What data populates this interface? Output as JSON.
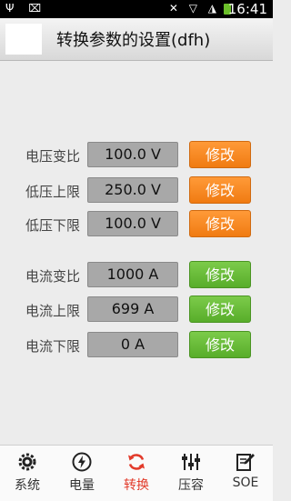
{
  "status_bar": {
    "left_icons": "Ψ ⌧",
    "right_icons": "✕ ▽ ◮",
    "time": "16:41"
  },
  "title_bar": {
    "title": "转换参数的设置(dfh)"
  },
  "rows": [
    {
      "label": "电压变比",
      "value": "100.0 V",
      "button": "修改",
      "color": "orange"
    },
    {
      "label": "低压上限",
      "value": "250.0 V",
      "button": "修改",
      "color": "orange"
    },
    {
      "label": "低压下限",
      "value": "100.0 V",
      "button": "修改",
      "color": "orange"
    },
    {
      "label": "电流变比",
      "value": "1000 A",
      "button": "修改",
      "color": "green"
    },
    {
      "label": "电流上限",
      "value": "699 A",
      "button": "修改",
      "color": "green"
    },
    {
      "label": "电流下限",
      "value": "0 A",
      "button": "修改",
      "color": "green"
    }
  ],
  "bottom_nav": [
    {
      "label": "系统",
      "icon": "gear-icon"
    },
    {
      "label": "电量",
      "icon": "power-icon"
    },
    {
      "label": "转换",
      "icon": "refresh-icon",
      "active": true
    },
    {
      "label": "压容",
      "icon": "sliders-icon"
    },
    {
      "label": "SOE",
      "icon": "edit-icon"
    }
  ],
  "colors": {
    "orange": "#f07b12",
    "green": "#58ad2a",
    "active": "#e23a2a"
  }
}
